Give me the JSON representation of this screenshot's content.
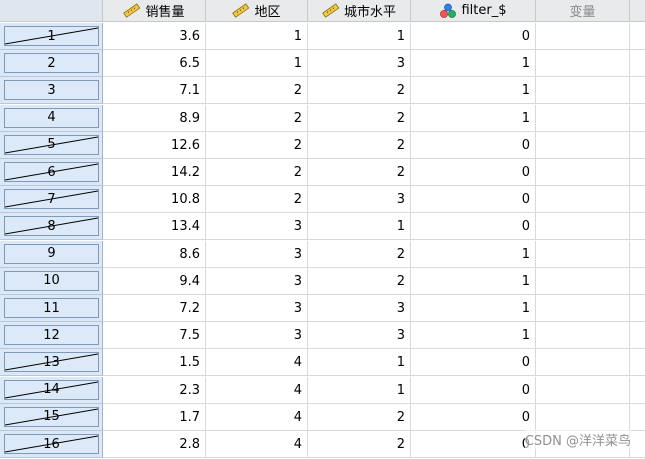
{
  "columns": [
    {
      "label": "销售量",
      "icon": "scale-ruler-icon"
    },
    {
      "label": "地区",
      "icon": "scale-ruler-icon"
    },
    {
      "label": "城市水平",
      "icon": "scale-ruler-icon"
    },
    {
      "label": "filter_$",
      "icon": "nominal-circles-icon"
    },
    {
      "label": "变量",
      "icon": ""
    }
  ],
  "rows": [
    {
      "num": "1",
      "filtered_out": true,
      "values": [
        "3.6",
        "1",
        "1",
        "0"
      ]
    },
    {
      "num": "2",
      "filtered_out": false,
      "values": [
        "6.5",
        "1",
        "3",
        "1"
      ]
    },
    {
      "num": "3",
      "filtered_out": false,
      "values": [
        "7.1",
        "2",
        "2",
        "1"
      ]
    },
    {
      "num": "4",
      "filtered_out": false,
      "values": [
        "8.9",
        "2",
        "2",
        "1"
      ]
    },
    {
      "num": "5",
      "filtered_out": true,
      "values": [
        "12.6",
        "2",
        "2",
        "0"
      ]
    },
    {
      "num": "6",
      "filtered_out": true,
      "values": [
        "14.2",
        "2",
        "2",
        "0"
      ]
    },
    {
      "num": "7",
      "filtered_out": true,
      "values": [
        "10.8",
        "2",
        "3",
        "0"
      ]
    },
    {
      "num": "8",
      "filtered_out": true,
      "values": [
        "13.4",
        "3",
        "1",
        "0"
      ]
    },
    {
      "num": "9",
      "filtered_out": false,
      "values": [
        "8.6",
        "3",
        "2",
        "1"
      ]
    },
    {
      "num": "10",
      "filtered_out": false,
      "values": [
        "9.4",
        "3",
        "2",
        "1"
      ]
    },
    {
      "num": "11",
      "filtered_out": false,
      "values": [
        "7.2",
        "3",
        "3",
        "1"
      ]
    },
    {
      "num": "12",
      "filtered_out": false,
      "values": [
        "7.5",
        "3",
        "3",
        "1"
      ]
    },
    {
      "num": "13",
      "filtered_out": true,
      "values": [
        "1.5",
        "4",
        "1",
        "0"
      ]
    },
    {
      "num": "14",
      "filtered_out": true,
      "values": [
        "2.3",
        "4",
        "1",
        "0"
      ]
    },
    {
      "num": "15",
      "filtered_out": true,
      "values": [
        "1.7",
        "4",
        "2",
        "0"
      ]
    },
    {
      "num": "16",
      "filtered_out": true,
      "values": [
        "2.8",
        "4",
        "2",
        "0"
      ]
    }
  ],
  "watermark": "CSDN @洋洋菜鸟",
  "colors": {
    "row_header_bg": "#dbe8f7",
    "header_bg": "#e9eaec",
    "grid_line": "#d6d9de"
  }
}
